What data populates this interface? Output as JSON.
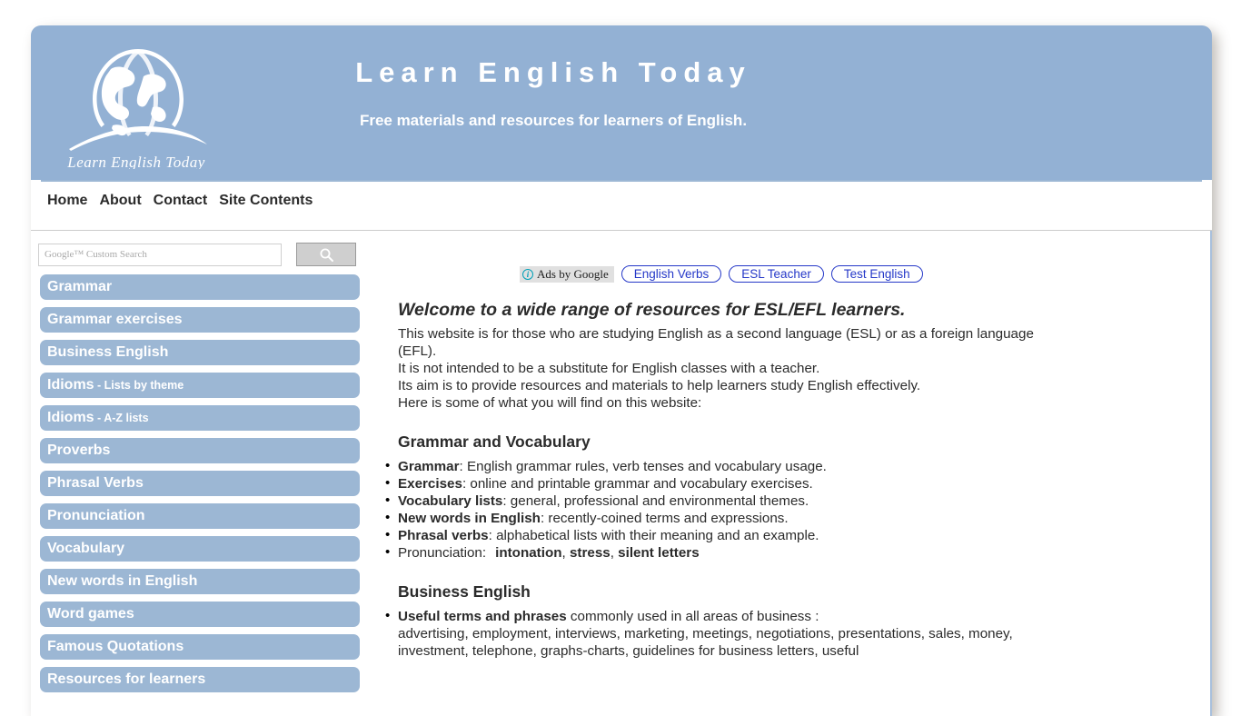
{
  "site": {
    "title": "Learn English Today",
    "tagline": "Free materials and resources for learners of English.",
    "logo_caption": "Learn English Today"
  },
  "nav": {
    "items": [
      {
        "label": "Home"
      },
      {
        "label": "About"
      },
      {
        "label": "Contact"
      },
      {
        "label": "Site Contents"
      }
    ]
  },
  "search": {
    "placeholder": "Google™ Custom Search",
    "value": "",
    "button_icon": "search-icon"
  },
  "sidebar": {
    "items": [
      {
        "label": "Grammar",
        "sub": ""
      },
      {
        "label": "Grammar exercises",
        "sub": ""
      },
      {
        "label": "Business English",
        "sub": ""
      },
      {
        "label": "Idioms",
        "sub": " - Lists by theme"
      },
      {
        "label": "Idioms",
        "sub": " - A-Z lists"
      },
      {
        "label": "Proverbs",
        "sub": ""
      },
      {
        "label": "Phrasal Verbs",
        "sub": ""
      },
      {
        "label": "Pronunciation",
        "sub": ""
      },
      {
        "label": "Vocabulary",
        "sub": ""
      },
      {
        "label": "New words in English",
        "sub": ""
      },
      {
        "label": "Word games",
        "sub": ""
      },
      {
        "label": "Famous Quotations",
        "sub": ""
      },
      {
        "label": "Resources for learners",
        "sub": ""
      }
    ]
  },
  "ads": {
    "label": "Ads by Google",
    "info_icon": "info-icon",
    "links": [
      {
        "label": "English Verbs"
      },
      {
        "label": "ESL Teacher"
      },
      {
        "label": "Test English"
      }
    ]
  },
  "main": {
    "welcome_heading": "Welcome to a wide range of resources for ESL/EFL learners.",
    "intro_lines": [
      "This website is for those who are studying English as a second language (ESL) or as a foreign language (EFL).",
      "It is not intended to be a substitute for English classes with a teacher.",
      "Its aim is to provide resources and materials to help learners study English effectively.",
      "Here is some of what you will find on this website:"
    ],
    "grammar_section": {
      "heading": "Grammar and Vocabulary",
      "items": [
        {
          "term": "Grammar",
          "rest": ": English grammar rules, verb tenses and vocabulary usage."
        },
        {
          "term": "Exercises",
          "rest": ": online and printable grammar and vocabulary exercises."
        },
        {
          "term": "Vocabulary lists",
          "rest": ": general, professional and environmental themes."
        },
        {
          "term": "New words in English",
          "rest": ": recently-coined terms and expressions."
        },
        {
          "term": "Phrasal verbs",
          "rest": ": alphabetical lists with their meaning and an example."
        }
      ],
      "pronunciation_label": "Pronunciation:",
      "pronunciation_links": [
        "intonation",
        "stress",
        "silent letters"
      ]
    },
    "business_section": {
      "heading": "Business English",
      "item_term": "Useful terms and phrases",
      "item_rest": " commonly used in all areas of business :",
      "detail_lines": [
        "advertising, employment, interviews, marketing, meetings, negotiations, presentations, sales, money,",
        "investment, telephone, graphs-charts, guidelines for business letters, useful"
      ]
    }
  },
  "colors": {
    "header_blue": "#93b1d4",
    "button_blue": "#9cb7d4",
    "ad_link_blue": "#2538c8",
    "text_dark": "#2b2b2b"
  }
}
